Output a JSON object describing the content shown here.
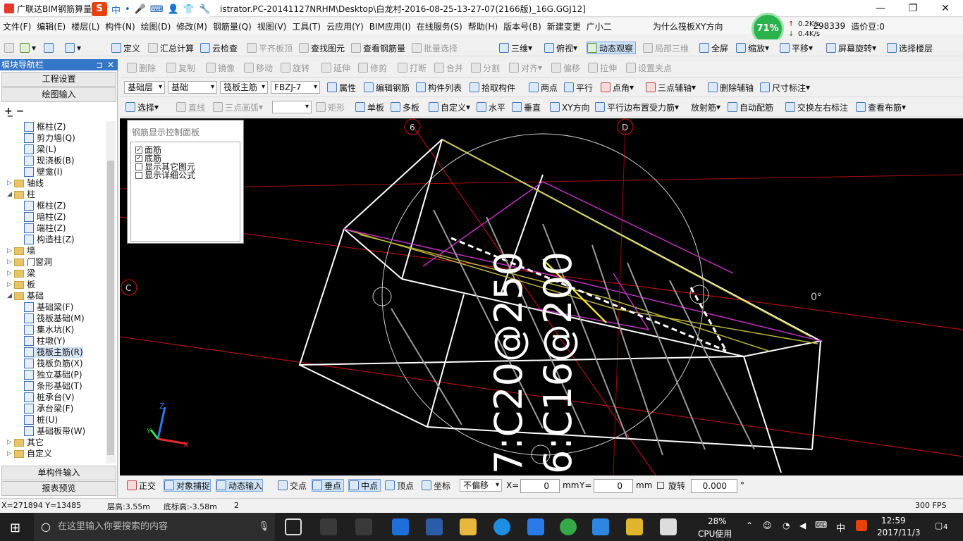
{
  "window": {
    "app_title": "广联达BIM钢筋算量",
    "path_title": "istrator.PC-20141127NRHM\\Desktop\\白龙村-2016-08-25-13-27-07(2166版)_16G.GGJ12]",
    "minimize": "—",
    "maximize": "❐",
    "close": "✕"
  },
  "ime": {
    "logo": "S",
    "mode": "中",
    "dot": "•",
    "mic": "🎤",
    "keyboard": "⌨",
    "person": "👤",
    "shirt": "👕",
    "tool": "🔧"
  },
  "menu": [
    "文件(F)",
    "编辑(E)",
    "楼层(L)",
    "构件(N)",
    "绘图(D)",
    "修改(M)",
    "钢筋量(Q)",
    "视图(V)",
    "工具(T)",
    "云应用(Y)",
    "BIM应用(I)",
    "在线服务(S)",
    "帮助(H)",
    "版本号(B)",
    "新建变更",
    "广小二"
  ],
  "menu_right": {
    "question": "为什么筏板XY方向",
    "network_percent": "71%",
    "up_speed": "0.2K/s",
    "down_speed": "0.4K/s",
    "user_id": "298339",
    "cost_label": "造价豆:0"
  },
  "toolbar1": {
    "define": "定义",
    "sum": "汇总计算",
    "cloud_check": "云检查",
    "flat_top": "平齐板顶",
    "find": "查找图元",
    "view_rebar": "查看钢筋量",
    "batch_select": "批量选择",
    "three_d": "三维",
    "top_view": "俯视",
    "dynamic_view": "动态观察",
    "local_3d": "局部三维",
    "full_screen": "全屏",
    "zoom": "缩放",
    "pan": "平移",
    "screen_rotate": "屏幕旋转",
    "select_floor": "选择楼层"
  },
  "toolbar2": [
    "删除",
    "复制",
    "镜像",
    "移动",
    "旋转",
    "延伸",
    "修剪",
    "打断",
    "合并",
    "分割",
    "对齐",
    "偏移",
    "拉伸",
    "设置夹点"
  ],
  "toolbar3": {
    "floor": "基础层",
    "category": "基础",
    "type": "筏板主筋",
    "element": "FBZJ-7",
    "items": [
      "属性",
      "编辑钢筋",
      "构件列表",
      "拾取构件",
      "两点",
      "平行",
      "点角",
      "三点辅轴",
      "删除辅轴",
      "尺寸标注"
    ]
  },
  "toolbar4": {
    "select": "选择",
    "line": "直线",
    "arc": "三点画弧",
    "rect": "矩形",
    "items": [
      "单板",
      "多板",
      "自定义",
      "水平",
      "垂直",
      "XY方向",
      "平行边布置受力筋",
      "放射筋",
      "自动配筋",
      "交换左右标注",
      "查看布筋"
    ]
  },
  "nav": {
    "header": "模块导航栏",
    "pin": "⊐",
    "close": "✕",
    "project_settings": "工程设置",
    "drawing_input": "绘图输入",
    "single_input": "单构件输入",
    "report_preview": "报表预览",
    "tree": [
      {
        "label": "框柱(Z)",
        "kind": "leaf",
        "indent": 2
      },
      {
        "label": "剪力墙(Q)",
        "kind": "leaf",
        "indent": 2
      },
      {
        "label": "梁(L)",
        "kind": "leaf",
        "indent": 2
      },
      {
        "label": "现浇板(B)",
        "kind": "leaf",
        "indent": 2
      },
      {
        "label": "壁龛(I)",
        "kind": "leaf",
        "indent": 2
      },
      {
        "label": "轴线",
        "kind": "folder",
        "indent": 1,
        "exp": "▷"
      },
      {
        "label": "柱",
        "kind": "folder",
        "indent": 1,
        "exp": "◢"
      },
      {
        "label": "框柱(Z)",
        "kind": "leaf",
        "indent": 2
      },
      {
        "label": "暗柱(Z)",
        "kind": "leaf",
        "indent": 2
      },
      {
        "label": "端柱(Z)",
        "kind": "leaf",
        "indent": 2
      },
      {
        "label": "构造柱(Z)",
        "kind": "leaf",
        "indent": 2
      },
      {
        "label": "墙",
        "kind": "folder",
        "indent": 1,
        "exp": "▷"
      },
      {
        "label": "门窗洞",
        "kind": "folder",
        "indent": 1,
        "exp": "▷"
      },
      {
        "label": "梁",
        "kind": "folder",
        "indent": 1,
        "exp": "▷"
      },
      {
        "label": "板",
        "kind": "folder",
        "indent": 1,
        "exp": "▷"
      },
      {
        "label": "基础",
        "kind": "folder",
        "indent": 1,
        "exp": "◢"
      },
      {
        "label": "基础梁(F)",
        "kind": "leaf",
        "indent": 2
      },
      {
        "label": "筏板基础(M)",
        "kind": "leaf",
        "indent": 2
      },
      {
        "label": "集水坑(K)",
        "kind": "leaf",
        "indent": 2
      },
      {
        "label": "柱墩(Y)",
        "kind": "leaf",
        "indent": 2
      },
      {
        "label": "筏板主筋(R)",
        "kind": "leaf",
        "indent": 2,
        "selected": true
      },
      {
        "label": "筏板负筋(X)",
        "kind": "leaf",
        "indent": 2
      },
      {
        "label": "独立基础(P)",
        "kind": "leaf",
        "indent": 2
      },
      {
        "label": "条形基础(T)",
        "kind": "leaf",
        "indent": 2
      },
      {
        "label": "桩承台(V)",
        "kind": "leaf",
        "indent": 2
      },
      {
        "label": "承台梁(F)",
        "kind": "leaf",
        "indent": 2
      },
      {
        "label": "桩(U)",
        "kind": "leaf",
        "indent": 2
      },
      {
        "label": "基础板带(W)",
        "kind": "leaf",
        "indent": 2
      },
      {
        "label": "其它",
        "kind": "folder",
        "indent": 1,
        "exp": "▷"
      },
      {
        "label": "自定义",
        "kind": "folder",
        "indent": 1,
        "exp": "▷"
      }
    ]
  },
  "panel": {
    "title": "钢筋显示控制面板",
    "options": [
      {
        "label": "面筋",
        "checked": true
      },
      {
        "label": "底筋",
        "checked": true
      },
      {
        "label": "显示其它图元",
        "checked": false
      },
      {
        "label": "显示详细公式",
        "checked": false
      }
    ]
  },
  "canvas": {
    "axis_6": "6",
    "axis_d": "D",
    "axis_c": "C",
    "angle": "0°",
    "rebar_text_1": "7:C20@250",
    "rebar_text_2": "6:C16@200",
    "axis_z": "Z",
    "axis_x": "X",
    "axis_y": "Y"
  },
  "snap": {
    "ortho": "正交",
    "object_snap": "对象捕捉",
    "dynamic_input": "动态输入",
    "intersect": "交点",
    "perpendicular": "垂点",
    "midpoint": "中点",
    "vertex": "顶点",
    "coordinate": "坐标",
    "offset": "不偏移",
    "x_label": "X=",
    "x_value": "0",
    "x_unit": "mm",
    "y_label": "Y=",
    "y_value": "0",
    "y_unit": "mm",
    "rotate": "旋转",
    "rotate_value": "0.000",
    "deg": "°"
  },
  "status": {
    "coords": "X=271894 Y=13485",
    "floor_height": "层高:3.55m",
    "bottom_elev": "底标高:-3.58m",
    "count": "2",
    "fps": "300 FPS"
  },
  "taskbar": {
    "search_placeholder": "在这里输入你要搜索的内容",
    "cpu_percent": "28%",
    "cpu_label": "CPU使用",
    "lang": "中",
    "time": "12:59",
    "date": "2017/11/3",
    "notif_count": "4"
  }
}
